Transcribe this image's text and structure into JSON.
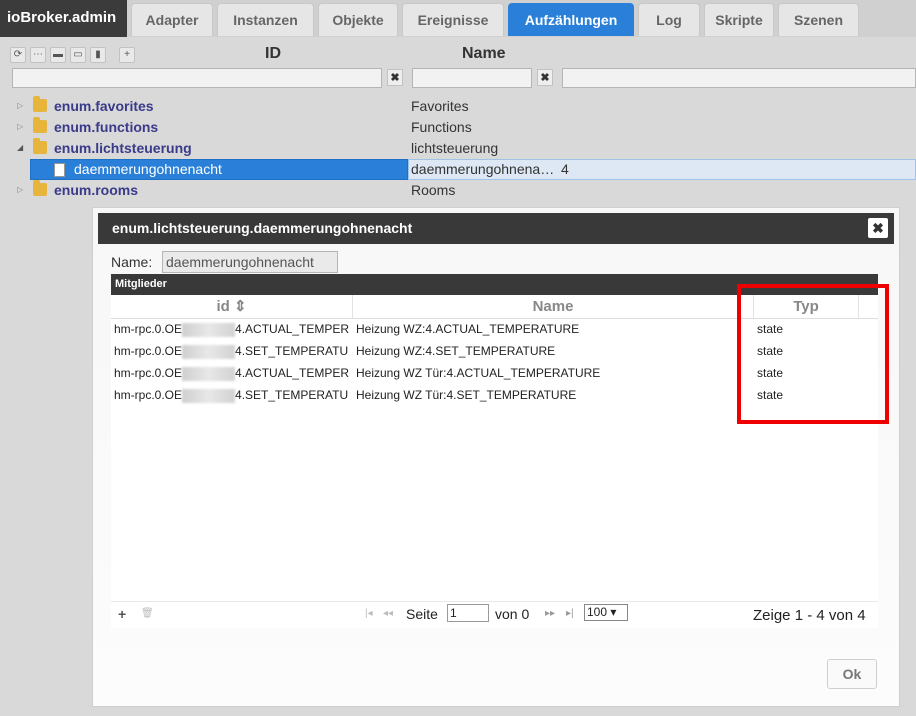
{
  "app": {
    "title": "ioBroker.admin"
  },
  "tabs": [
    {
      "label": "Adapter"
    },
    {
      "label": "Instanzen"
    },
    {
      "label": "Objekte"
    },
    {
      "label": "Ereignisse"
    },
    {
      "label": "Aufzählungen",
      "active": true
    },
    {
      "label": "Log"
    },
    {
      "label": "Skripte"
    },
    {
      "label": "Szenen"
    }
  ],
  "toolbar": {
    "icons": [
      "refresh-icon",
      "collapse-icon",
      "folder-closed-icon",
      "folder-open-icon",
      "edit-icon",
      "add-icon"
    ],
    "add_glyph": "+"
  },
  "columns": {
    "id": "ID",
    "name": "Name"
  },
  "filters": {
    "clear_glyph": "✖"
  },
  "tree": [
    {
      "id": "enum.favorites",
      "name": "Favorites"
    },
    {
      "id": "enum.functions",
      "name": "Functions"
    },
    {
      "id": "enum.lichtsteuerung",
      "name": "lichtsteuerung"
    },
    {
      "id": "daemmerungohnenacht",
      "name": "daemmerungohnena…",
      "count": "4"
    },
    {
      "id": "enum.rooms",
      "name": "Rooms"
    }
  ],
  "dialog": {
    "title": "enum.lichtsteuerung.daemmerungohnenacht",
    "close_glyph": "✖",
    "name_label": "Name:",
    "name_value": "daemmerungohnenacht",
    "grid_caption": "Mitglieder",
    "headers": {
      "id": "id ⇕",
      "name": "Name",
      "typ": "Typ"
    },
    "rows": [
      {
        "id_prefix": "hm-rpc.0.OE",
        "id_suffix": "4.ACTUAL_TEMPER",
        "name": "Heizung WZ:4.ACTUAL_TEMPERATURE",
        "typ": "state"
      },
      {
        "id_prefix": "hm-rpc.0.OE",
        "id_suffix": "4.SET_TEMPERATU",
        "name": "Heizung WZ:4.SET_TEMPERATURE",
        "typ": "state"
      },
      {
        "id_prefix": "hm-rpc.0.OE",
        "id_suffix": "4.ACTUAL_TEMPER",
        "name": "Heizung WZ Tür:4.ACTUAL_TEMPERATURE",
        "typ": "state"
      },
      {
        "id_prefix": "hm-rpc.0.OE",
        "id_suffix": "4.SET_TEMPERATU",
        "name": "Heizung WZ Tür:4.SET_TEMPERATURE",
        "typ": "state"
      }
    ],
    "pager": {
      "add_glyph": "+",
      "delete_glyph": "🗑",
      "first_glyph": "|◂",
      "prev_glyph": "◂◂",
      "page_label": "Seite",
      "page_value": "1",
      "of_label": "von 0",
      "next_glyph": "▸▸",
      "last_glyph": "▸|",
      "page_size": "100 ▾",
      "summary": "Zeige 1 - 4 von 4"
    },
    "ok_label": "Ok"
  },
  "colors": {
    "accent": "#2a80d8",
    "highlight": "#ee0000",
    "folder": "#e7b53c"
  }
}
